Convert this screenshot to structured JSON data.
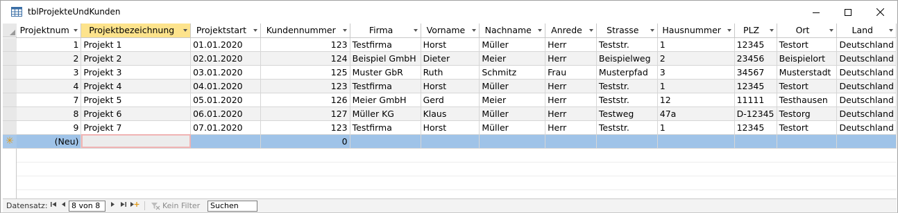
{
  "window": {
    "title": "tblProjekteUndKunden",
    "icon": "table-icon"
  },
  "columns": [
    {
      "label": "Projektnum"
    },
    {
      "label": "Projektbezeichnung"
    },
    {
      "label": "Projektstart"
    },
    {
      "label": "Kundennummer"
    },
    {
      "label": "Firma"
    },
    {
      "label": "Vorname"
    },
    {
      "label": "Nachname"
    },
    {
      "label": "Anrede"
    },
    {
      "label": "Strasse"
    },
    {
      "label": "Hausnummer"
    },
    {
      "label": "PLZ"
    },
    {
      "label": "Ort"
    },
    {
      "label": "Land"
    }
  ],
  "rows": [
    [
      "1",
      "Projekt 1",
      "01.01.2020",
      "123",
      "Testfirma",
      "Horst",
      "Müller",
      "Herr",
      "Teststr.",
      "1",
      "12345",
      "Testort",
      "Deutschland"
    ],
    [
      "2",
      "Projekt 2",
      "02.01.2020",
      "124",
      "Beispiel GmbH",
      "Dieter",
      "Meier",
      "Herr",
      "Beispielweg",
      "2",
      "23456",
      "Beispielort",
      "Deutschland"
    ],
    [
      "3",
      "Projekt 3",
      "03.01.2020",
      "125",
      "Muster GbR",
      "Ruth",
      "Schmitz",
      "Frau",
      "Musterpfad",
      "3",
      "34567",
      "Musterstadt",
      "Deutschland"
    ],
    [
      "4",
      "Projekt 4",
      "04.01.2020",
      "123",
      "Testfirma",
      "Horst",
      "Müller",
      "Herr",
      "Teststr.",
      "1",
      "12345",
      "Testort",
      "Deutschland"
    ],
    [
      "7",
      "Projekt 5",
      "05.01.2020",
      "126",
      "Meier GmbH",
      "Gerd",
      "Meier",
      "Herr",
      "Teststr.",
      "12",
      "11111",
      "Testhausen",
      "Deutschland"
    ],
    [
      "8",
      "Projekt 6",
      "06.01.2020",
      "127",
      "Müller KG",
      "Klaus",
      "Müller",
      "Herr",
      "Testweg",
      "47a",
      "D-12345",
      "Testorg",
      "Deutschland"
    ],
    [
      "9",
      "Projekt 7",
      "07.01.2020",
      "123",
      "Testfirma",
      "Horst",
      "Müller",
      "Herr",
      "Teststr.",
      "1",
      "12345",
      "Testort",
      "Deutschland"
    ]
  ],
  "new_row": {
    "id_label": "(Neu)",
    "kundennummer": "0",
    "marker": "✳"
  },
  "statusbar": {
    "label": "Datensatz:",
    "record": "8 von 8",
    "filter_label": "Kein Filter",
    "search_placeholder": "Suchen"
  },
  "colors": {
    "sorted_header": "#fde38c",
    "new_row": "#9fc3e8",
    "focus_outline": "#f0b3b3"
  }
}
